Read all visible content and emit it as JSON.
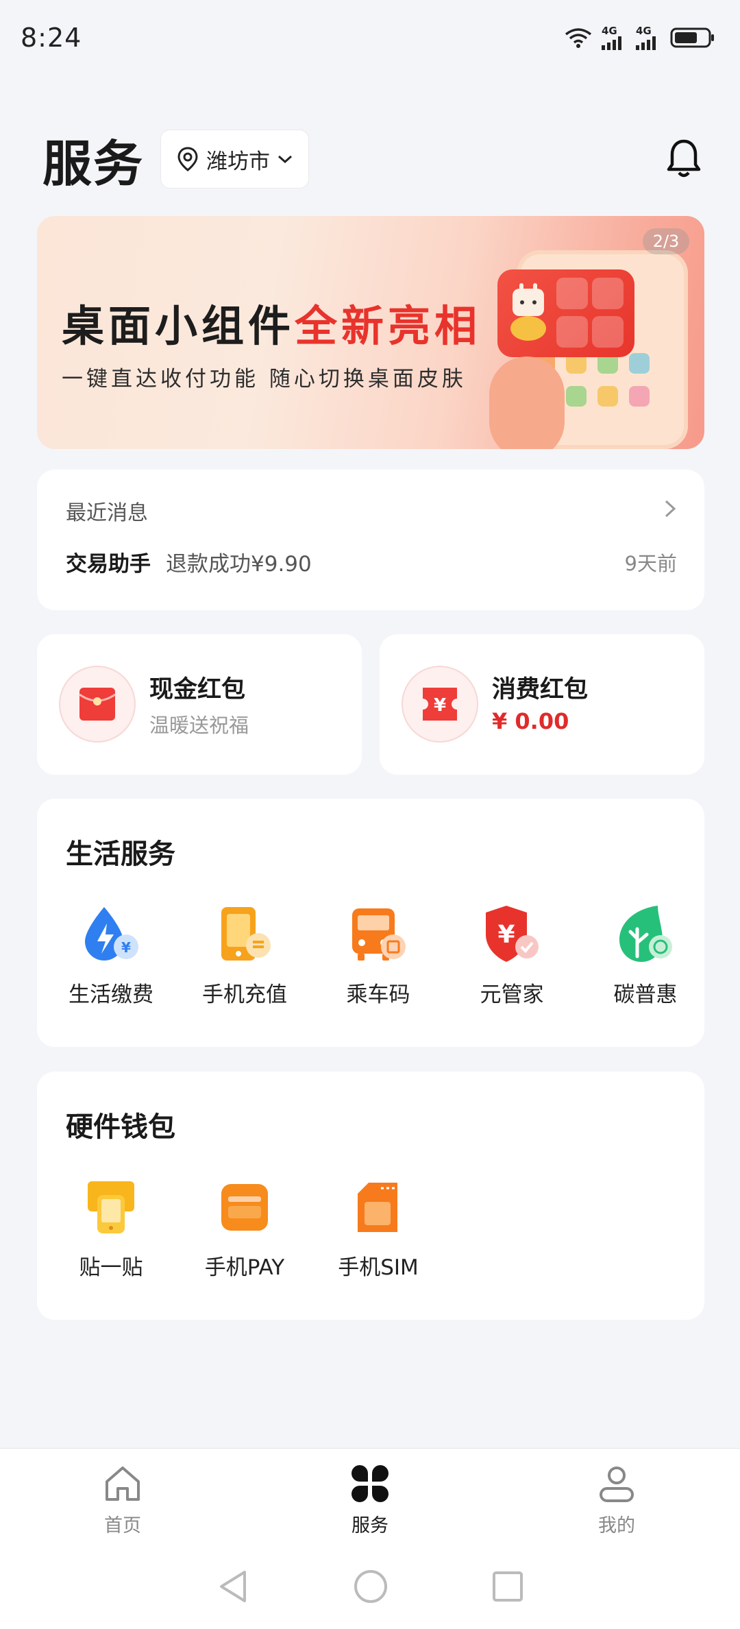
{
  "status_bar": {
    "time": "8:24",
    "network_1": "4G",
    "network_2": "4G",
    "icons": [
      "wifi-icon",
      "signal-icon",
      "signal-icon",
      "battery-icon"
    ]
  },
  "header": {
    "title": "服务",
    "city": "潍坊市",
    "icons": [
      "location-pin-icon",
      "chevron-down-icon",
      "bell-icon"
    ]
  },
  "banner": {
    "headline_black": "桌面小组件",
    "headline_red": "全新亮相",
    "subtitle": "一键直达收付功能  随心切换桌面皮肤",
    "page_indicator": "2/3"
  },
  "recent_messages": {
    "label": "最近消息",
    "sender": "交易助手",
    "message": "退款成功¥9.90",
    "time": "9天前"
  },
  "red_packets": [
    {
      "title": "现金红包",
      "subtitle": "温暖送祝福",
      "icon": "red-envelope-icon"
    },
    {
      "title": "消费红包",
      "amount": "¥ 0.00",
      "icon": "yuan-coupon-icon"
    }
  ],
  "life_services": {
    "title": "生活服务",
    "items": [
      {
        "label": "生活缴费",
        "icon": "utility-bill-icon"
      },
      {
        "label": "手机充值",
        "icon": "phone-recharge-icon"
      },
      {
        "label": "乘车码",
        "icon": "bus-code-icon"
      },
      {
        "label": "元管家",
        "icon": "yuan-shield-icon"
      },
      {
        "label": "碳普惠",
        "icon": "carbon-leaf-icon"
      }
    ]
  },
  "hardware_wallet": {
    "title": "硬件钱包",
    "items": [
      {
        "label": "贴一贴",
        "icon": "tap-card-icon"
      },
      {
        "label": "手机PAY",
        "icon": "wallet-card-icon"
      },
      {
        "label": "手机SIM",
        "icon": "sim-card-icon"
      }
    ]
  },
  "bottom_nav": {
    "items": [
      {
        "label": "首页",
        "icon": "home-icon",
        "active": false
      },
      {
        "label": "服务",
        "icon": "four-petal-icon",
        "active": true
      },
      {
        "label": "我的",
        "icon": "profile-icon",
        "active": false
      }
    ]
  },
  "colors": {
    "accent_red": "#e8332c",
    "amount_red": "#e02b2b",
    "page_bg": "#f4f5f9"
  }
}
